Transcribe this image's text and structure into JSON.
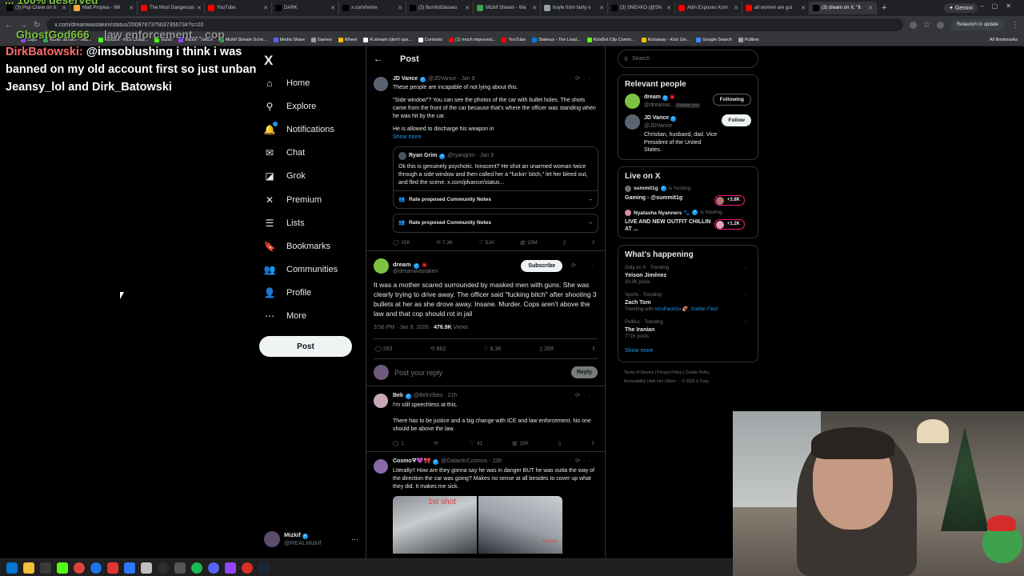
{
  "browser": {
    "tabs": [
      {
        "label": "(3) Pop Crave on X",
        "color": "#000000",
        "active": false
      },
      {
        "label": "Matt Propwa - IMI",
        "color": "#f4a742",
        "active": false
      },
      {
        "label": "The Most Dangerous",
        "color": "#ff0000",
        "active": false
      },
      {
        "label": "YouTube",
        "color": "#ff0000",
        "active": false
      },
      {
        "label": "DARK",
        "color": "#000000",
        "active": false
      },
      {
        "label": "x.com/home",
        "color": "#000000",
        "active": false
      },
      {
        "label": "(3) BurritoGlasses",
        "color": "#000000",
        "active": false
      },
      {
        "label": "Mizkif Stream - Wa",
        "color": "#34a853",
        "active": false
      },
      {
        "label": "boyle from fairly o",
        "color": "#9aa0a6",
        "active": false
      },
      {
        "label": "(3) SNEAKO (@SN",
        "color": "#000000",
        "active": false
      },
      {
        "label": "Adin Exposes Kom",
        "color": "#ff0000",
        "active": false
      },
      {
        "label": "all women are gui",
        "color": "#ff0000",
        "active": false
      },
      {
        "label": "(3) dream on X: \"It",
        "color": "#000000",
        "active": true
      }
    ],
    "gemini_label": "Gemini",
    "url": "x.com/dreamwastaken/status/2009767375637356734?s=20",
    "relaunch_label": "Relaunch to update",
    "bookmarks": [
      {
        "label": "Clips",
        "color": "#9146ff"
      },
      {
        "label": "Mizkif Stream - Wat...",
        "color": "#34a853"
      },
      {
        "label": "KickBot - Kick Chatb...",
        "color": "#53fc18"
      },
      {
        "label": "Mizkif",
        "color": "#53fc18"
      },
      {
        "label": "Mizkif - Twitch",
        "color": "#9146ff"
      },
      {
        "label": "Mizkif Stream Sche...",
        "color": "#34a853"
      },
      {
        "label": "Media Share",
        "color": "#5865f2"
      },
      {
        "label": "Games",
        "color": "#9aa0a6"
      },
      {
        "label": "Wheel",
        "color": "#fbbc04"
      },
      {
        "label": "R.stream (don't ope...",
        "color": "#ffffff"
      },
      {
        "label": "Contexto",
        "color": "#ffffff"
      },
      {
        "label": "(1) much improved...",
        "color": "#ff0000"
      },
      {
        "label": "YouTube",
        "color": "#ff0000"
      },
      {
        "label": "Stakeus - The Lead...",
        "color": "#1475e1"
      },
      {
        "label": "KickBot Clip Comm...",
        "color": "#53fc18"
      },
      {
        "label": "Kickaway - Kick Giv...",
        "color": "#fbbc04"
      },
      {
        "label": "Google Search",
        "color": "#4285f4"
      },
      {
        "label": "Pullbox",
        "color": "#9aa0a6"
      }
    ],
    "all_bookmarks": "All Bookmarks"
  },
  "overlay": {
    "faded_top": "... 100% deserved",
    "faded_user": "GhostGod666",
    "faded_text": "law enforcement... cop",
    "chat_user": "DirkBatowski:",
    "chat_message": "@imsoblushing i think i was banned on my old account first so just unban Jeansy_lol and Dirk_Batowski"
  },
  "sidebar": {
    "logo": "X",
    "items": [
      {
        "label": "Home",
        "icon": "home-icon",
        "glyph": "⌂"
      },
      {
        "label": "Explore",
        "icon": "search-icon",
        "glyph": "⚲"
      },
      {
        "label": "Notifications",
        "icon": "bell-icon",
        "glyph": "🔔"
      },
      {
        "label": "Chat",
        "icon": "chat-icon",
        "glyph": "✉"
      },
      {
        "label": "Grok",
        "icon": "grok-icon",
        "glyph": "◪"
      },
      {
        "label": "Premium",
        "icon": "x-premium-icon",
        "glyph": "✕"
      },
      {
        "label": "Lists",
        "icon": "list-icon",
        "glyph": "☰"
      },
      {
        "label": "Bookmarks",
        "icon": "bookmark-icon",
        "glyph": "🔖"
      },
      {
        "label": "Communities",
        "icon": "communities-icon",
        "glyph": "👥"
      },
      {
        "label": "Profile",
        "icon": "profile-icon",
        "glyph": "👤"
      },
      {
        "label": "More",
        "icon": "more-circle-icon",
        "glyph": "⋯"
      }
    ],
    "post_label": "Post",
    "account": {
      "name": "Mizkif",
      "handle": "@REALMizkif"
    }
  },
  "main": {
    "back": "←",
    "title": "Post",
    "parent": {
      "name": "JD Vance",
      "handle": "@JDVance · Jan 9",
      "p1": "These people are incapable of not lying about this.",
      "p2": "\"Side window\"? You can see the photos of the car with bullet holes. The shots came from the front of the car because that's where the officer was standing when he was hit by the car.",
      "p3": "He is allowed to discharge his weapon in",
      "show_more": "Show more",
      "quote": {
        "name": "Ryan Grim",
        "handle": "@ryangrim · Jan 9",
        "text": "Ok this is genuinely psychotic. Innocent? He shot an unarmed woman twice through a side window and then called her a \"fuckin' bitch,\" let her bleed out, and fled the scene. x.com/jdvance/status..."
      },
      "cn_quote": "Rate proposed Community Notes",
      "cn_main": "Rate proposed Community Notes",
      "metrics": {
        "replies": "15K",
        "reposts": "7.3K",
        "likes": "51K",
        "views": "10M"
      }
    },
    "focus": {
      "name": "dream",
      "handle": "@dreamwastaken",
      "subscribe": "Subscribe",
      "text": "It was a mother scared surrounded by masked men with guns. She was clearly trying to drive away. The officer said \"fucking bitch\" after shooting 3 bullets at her as she drove away. Insane. Murder. Cops aren't above the law and that cop should rot in jail",
      "time": "3:56 PM · Jan 9, 2026 · ",
      "views_count": "476.9K",
      "views_label": " Views",
      "metrics": {
        "replies": "283",
        "reposts": "862",
        "likes": "8.3K",
        "bookmarks": "268"
      }
    },
    "reply_placeholder": "Post your reply",
    "reply_button": "Reply",
    "replies": [
      {
        "name": "Bek",
        "handle": "@BekVibes · 21h",
        "p1": "I'm still speechless at this.",
        "p2": "There has to be justice and a big change with ICE and law enforcement. No one should be above the law.",
        "metrics": {
          "replies": "1",
          "reposts": "",
          "likes": "41",
          "views": "15K"
        },
        "avatar_color": "#c9a7b8"
      },
      {
        "name": "Cosmo🜃💜🎀",
        "handle": "@GalacticCosmos · 23h",
        "p1": "Literally!! How are they gonna say he was in danger BUT he was outta the way of the direction the car was going? Makes no sense at all besides to cover up what they did. It makes me sick.",
        "media_label": "1st shot",
        "media_label2": "2nd shot",
        "avatar_color": "#8a6aa8"
      }
    ]
  },
  "right": {
    "search_placeholder": "Search",
    "relevant_title": "Relevant people",
    "people": [
      {
        "name": "dream",
        "handle": "@dreamw...",
        "follows_you": "Follows you",
        "button": "Following",
        "bio": "",
        "color": "#7ec242"
      },
      {
        "name": "JD Vance",
        "handle": "@JDVance",
        "follows_you": "",
        "button": "Follow",
        "bio": "Christian, husband, dad. Vice President of the United States.",
        "color": "#5a6470"
      }
    ],
    "live_title": "Live on X",
    "live": [
      {
        "host": "summit1g",
        "status": " is hosting",
        "title": "Gaming - @summit1g",
        "count": "+3.8K"
      },
      {
        "host": "Nyatasha Nyanners 🐾",
        "status": " is hosting",
        "title": "LIVE AND NEW OUTFIT CHILLIN AT ...",
        "count": "+1.2K"
      }
    ],
    "happening_title": "What's happening",
    "trends": [
      {
        "context": "Only on X · Trending",
        "name": "Yeison Jiménez",
        "posts": "20.3K posts",
        "link_prefix": "",
        "link": ""
      },
      {
        "context": "Sports · Trending",
        "name": "Zach Tom",
        "posts": "",
        "link_prefix": "Trending with ",
        "link": "#GoPackGo 🏈, Soldier Field"
      },
      {
        "context": "Politics · Trending",
        "name": "The Iranian",
        "posts": "771K posts",
        "link_prefix": "",
        "link": ""
      }
    ],
    "show_more": "Show more",
    "footer_line1": "Terms of Service  |  Privacy Policy  |  Cookie Policy",
    "footer_line2": "Accessibility  |  Ads info  |  More ···  © 2026 X Corp."
  }
}
